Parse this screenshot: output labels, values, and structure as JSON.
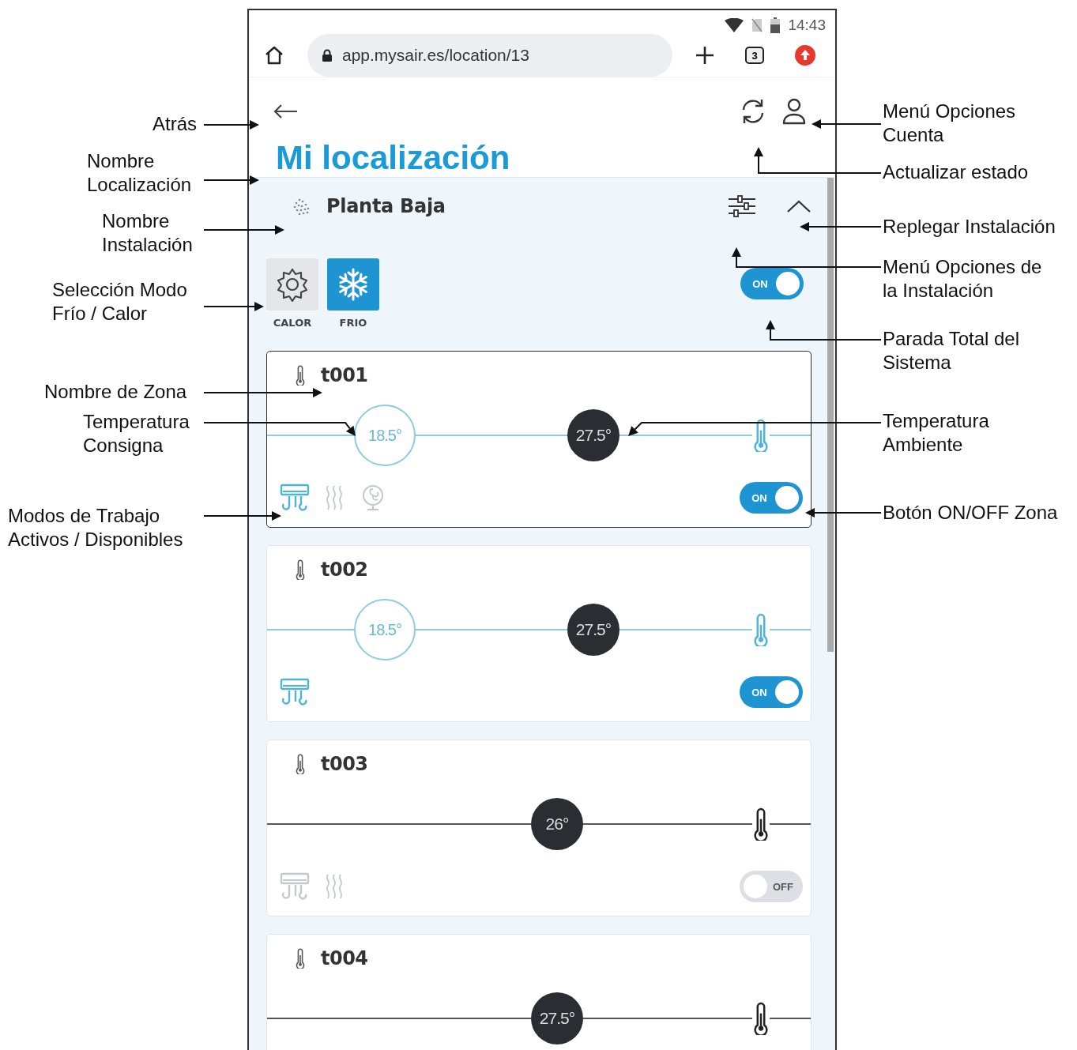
{
  "status_bar": {
    "time": "14:43"
  },
  "browser": {
    "url": "app.mysair.es/location/13",
    "tab_count": "3"
  },
  "location": {
    "title": "Mi localización"
  },
  "installation": {
    "name": "Planta Baja",
    "expanded": true,
    "power_on": true,
    "power_label": "ON",
    "modes": [
      {
        "label": "CALOR",
        "kind": "heat",
        "selected": false
      },
      {
        "label": "FRIO",
        "kind": "cool",
        "selected": true
      }
    ]
  },
  "zones": [
    {
      "name": "t001",
      "selected": true,
      "setpoint": "18.5°",
      "ambient": "27.5°",
      "on": true,
      "switch_label": "ON",
      "work_modes": [
        {
          "kind": "cool",
          "active": true
        },
        {
          "kind": "heat",
          "active": false
        },
        {
          "kind": "fan",
          "active": false
        }
      ]
    },
    {
      "name": "t002",
      "selected": false,
      "setpoint": "18.5°",
      "ambient": "27.5°",
      "on": true,
      "switch_label": "ON",
      "work_modes": [
        {
          "kind": "cool",
          "active": true
        }
      ]
    },
    {
      "name": "t003",
      "selected": false,
      "ambient": "26°",
      "on": false,
      "switch_label": "OFF",
      "work_modes": [
        {
          "kind": "cool",
          "active": false
        },
        {
          "kind": "heat",
          "active": false
        }
      ]
    },
    {
      "name": "t004",
      "selected": false,
      "ambient": "27.5°",
      "on": false
    }
  ],
  "annotations": [
    {
      "text": "Atrás"
    },
    {
      "text": "Nombre\nLocalización"
    },
    {
      "text": "Nombre\nInstalación"
    },
    {
      "text": "Selección Modo\nFrío / Calor"
    },
    {
      "text": "Nombre de Zona"
    },
    {
      "text": "Temperatura\nConsigna"
    },
    {
      "text": "Modos de Trabajo\nActivos / Disponibles"
    },
    {
      "text": "Menú Opciones\nCuenta"
    },
    {
      "text": "Actualizar estado"
    },
    {
      "text": "Replegar Instalación"
    },
    {
      "text": "Menú Opciones de\nla Instalación"
    },
    {
      "text": "Parada Total del\nSistema"
    },
    {
      "text": "Temperatura\nAmbiente"
    },
    {
      "text": "Botón ON/OFF Zona"
    }
  ]
}
